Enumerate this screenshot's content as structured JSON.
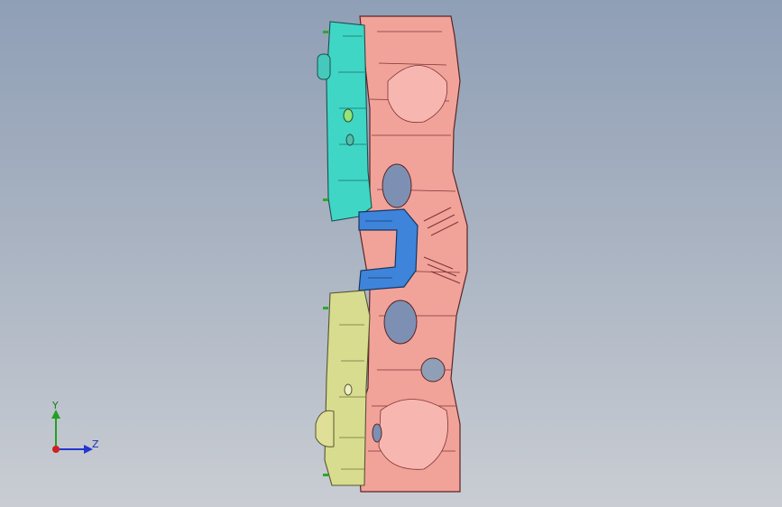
{
  "viewport": {
    "background_top": "#8f9fb6",
    "background_bottom": "#c9cdd3"
  },
  "model": {
    "parts": [
      {
        "name": "main-panel",
        "color": "#f2a29a"
      },
      {
        "name": "upper-bracket",
        "color": "#3fd6c6"
      },
      {
        "name": "lower-bracket",
        "color": "#d8dc8e"
      },
      {
        "name": "center-reinforcement",
        "color": "#3a7fd8"
      }
    ]
  },
  "triad": {
    "y_label": "Y",
    "z_label": "Z",
    "y_color": "#22a022",
    "z_color": "#2436d0",
    "x_color": "#d02020"
  }
}
